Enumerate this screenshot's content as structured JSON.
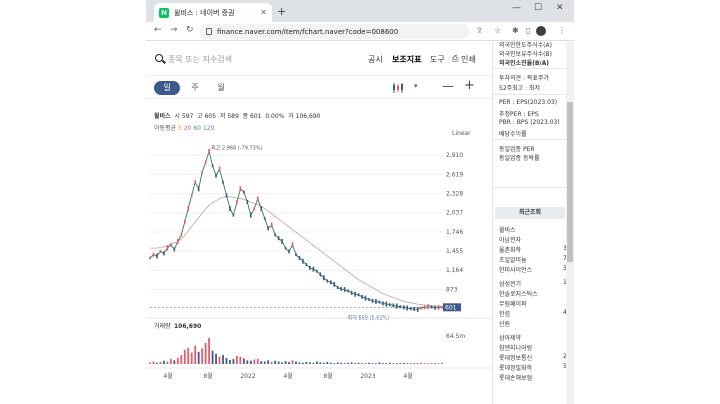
{
  "browser": {
    "tab_title": "윌비스 : 네이버 증권",
    "favicon_letter": "N",
    "url": "finance.naver.com/item/fchart.naver?code=008600"
  },
  "header": {
    "search_placeholder": "종목 또는 지수검색",
    "menu": [
      "공시",
      "보조지표",
      "도구",
      "인쇄"
    ],
    "active_menu": "보조지표"
  },
  "periods": [
    "일",
    "주",
    "월"
  ],
  "active_period": "일",
  "quote": {
    "name": "윌비스",
    "open_label": "시",
    "open": "597",
    "high_label": "고",
    "high": "605",
    "low_label": "저",
    "low": "589",
    "close_label": "종",
    "close": "601",
    "change": "0.00%",
    "volume_label": "거",
    "volume": "106,690"
  },
  "ma": {
    "label": "이동평균",
    "p5": "5",
    "p20": "20",
    "p60": "60",
    "p120": "120"
  },
  "scale_mode": "Linear",
  "chart_data": {
    "type": "line",
    "y_ticks": [
      2910,
      2619,
      2328,
      2037,
      1746,
      1455,
      1164,
      873
    ],
    "ylim": [
      560,
      3050
    ],
    "x_labels": [
      "4월",
      "8월",
      "2022",
      "4월",
      "8월",
      "2023",
      "4월"
    ],
    "max_annotation": "최고 2,968 (-79.73%)",
    "min_annotation": "최저 569 (5.62%)",
    "current_price": "601",
    "volume_title": "거래량",
    "volume_value": "106,690",
    "volume_axis_label": "64.5m",
    "price": [
      1350,
      1400,
      1380,
      1450,
      1420,
      1500,
      1550,
      1480,
      1600,
      1700,
      1900,
      2100,
      2300,
      2500,
      2400,
      2650,
      2800,
      2968,
      2750,
      2600,
      2700,
      2500,
      2300,
      2100,
      2000,
      2200,
      2400,
      2350,
      2200,
      2000,
      2100,
      2250,
      2100,
      1950,
      1800,
      1850,
      1700,
      1650,
      1600,
      1500,
      1450,
      1550,
      1400,
      1350,
      1300,
      1250,
      1200,
      1180,
      1150,
      1100,
      1050,
      1000,
      980,
      950,
      900,
      880,
      870,
      850,
      820,
      800,
      790,
      760,
      740,
      720,
      700,
      690,
      680,
      660,
      650,
      640,
      630,
      620,
      610,
      600,
      590,
      580,
      575,
      569,
      590,
      600,
      610,
      605,
      595,
      600,
      601
    ],
    "ma_slow": [
      1500,
      1500,
      1500,
      1510,
      1520,
      1540,
      1560,
      1580,
      1600,
      1640,
      1700,
      1760,
      1830,
      1900,
      1960,
      2030,
      2090,
      2150,
      2190,
      2220,
      2250,
      2270,
      2280,
      2280,
      2270,
      2260,
      2250,
      2240,
      2220,
      2200,
      2180,
      2160,
      2130,
      2100,
      2060,
      2020,
      1980,
      1940,
      1900,
      1860,
      1820,
      1780,
      1740,
      1700,
      1660,
      1620,
      1580,
      1540,
      1500,
      1460,
      1420,
      1380,
      1340,
      1300,
      1260,
      1220,
      1180,
      1140,
      1100,
      1060,
      1020,
      990,
      960,
      930,
      900,
      870,
      840,
      810,
      790,
      770,
      750,
      730,
      710,
      690,
      680,
      670,
      660,
      650,
      640,
      635,
      630,
      625,
      620,
      615,
      612
    ],
    "volume": [
      4,
      6,
      3,
      5,
      8,
      6,
      12,
      9,
      15,
      22,
      35,
      40,
      28,
      45,
      30,
      38,
      52,
      64,
      33,
      25,
      18,
      22,
      15,
      10,
      12,
      20,
      18,
      14,
      9,
      8,
      11,
      13,
      7,
      6,
      9,
      5,
      8,
      6,
      4,
      7,
      5,
      9,
      6,
      4,
      3,
      5,
      4,
      3,
      6,
      4,
      3,
      5,
      3,
      2,
      4,
      3,
      2,
      3,
      4,
      2,
      3,
      2,
      2,
      3,
      2,
      2,
      4,
      2,
      2,
      3,
      2,
      2,
      2,
      3,
      2,
      2,
      2,
      2,
      3,
      2,
      2,
      2,
      2,
      2,
      3
    ]
  },
  "right_panel": {
    "top_items": [
      "외국인한도주식수(A)",
      "외국인보유주식수(B)",
      "외국인소진율(B/A)"
    ],
    "opinion_items": [
      "투자의견 : 목표주가",
      "52주최고 : 최저"
    ],
    "valuation_items": [
      "PER : EPS(2023.03)",
      "추정PER : EPS",
      "PBR : BPS (2023.03)",
      "배당수익률"
    ],
    "industry_items": [
      "동일업종 PER",
      "동일업종 등락률"
    ],
    "recent_title": "최근조회",
    "recent": [
      {
        "name": "윌비스",
        "count": ""
      },
      {
        "name": "아남전자",
        "count": ""
      },
      {
        "name": "율촌화학",
        "count": "3"
      },
      {
        "name": "조일알미늄",
        "count": "7"
      },
      {
        "name": "한미사이언스",
        "count": "3"
      },
      {
        "name": "삼성전기",
        "count": "14"
      },
      {
        "name": "한솔로지스틱스",
        "count": ""
      },
      {
        "name": "무림페이퍼",
        "count": ""
      },
      {
        "name": "한섬",
        "count": "4"
      },
      {
        "name": "신원",
        "count": ""
      },
      {
        "name": "삼아제약",
        "count": ""
      },
      {
        "name": "참엔지니어링",
        "count": ""
      },
      {
        "name": "롯데정보통신",
        "count": "2"
      },
      {
        "name": "롯데정밀화학",
        "count": "5"
      },
      {
        "name": "롯데손해보험",
        "count": ""
      }
    ]
  }
}
